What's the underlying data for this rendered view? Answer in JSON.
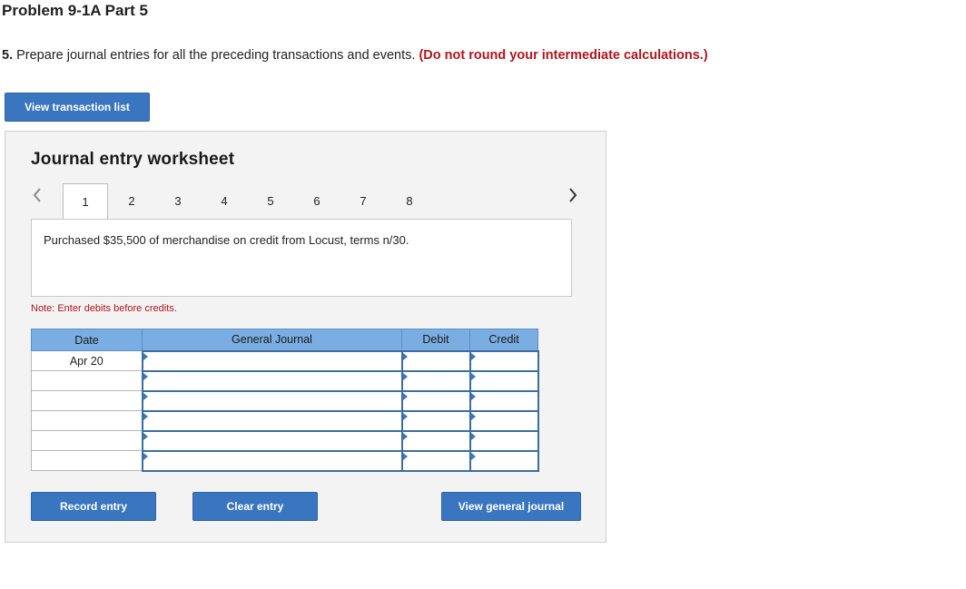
{
  "page": {
    "title": "Problem 9-1A Part 5",
    "instruction_number": "5.",
    "instruction_text": " Prepare journal entries for all the preceding transactions and events. ",
    "instruction_note": "(Do not round your intermediate calculations.)"
  },
  "buttons": {
    "view_transaction_list": "View transaction list",
    "record_entry": "Record entry",
    "clear_entry": "Clear entry",
    "view_general_journal": "View general journal"
  },
  "worksheet": {
    "title": "Journal entry worksheet",
    "tabs": [
      "1",
      "2",
      "3",
      "4",
      "5",
      "6",
      "7",
      "8"
    ],
    "active_tab": "1",
    "description": "Purchased $35,500 of merchandise on credit from Locust, terms n/30.",
    "note": "Note: Enter debits before credits."
  },
  "journal": {
    "headers": {
      "date": "Date",
      "general_journal": "General Journal",
      "debit": "Debit",
      "credit": "Credit"
    },
    "rows": [
      {
        "date": "Apr 20",
        "account": "",
        "debit": "",
        "credit": ""
      },
      {
        "date": "",
        "account": "",
        "debit": "",
        "credit": ""
      },
      {
        "date": "",
        "account": "",
        "debit": "",
        "credit": ""
      },
      {
        "date": "",
        "account": "",
        "debit": "",
        "credit": ""
      },
      {
        "date": "",
        "account": "",
        "debit": "",
        "credit": ""
      },
      {
        "date": "",
        "account": "",
        "debit": "",
        "credit": ""
      }
    ]
  },
  "icons": {
    "prev": "chevron-left-icon",
    "next": "chevron-right-icon"
  },
  "colors": {
    "button": "#3a76c0",
    "table_header": "#7aaee3",
    "note_red": "#b0151b",
    "panel_bg": "#f3f3f3"
  }
}
